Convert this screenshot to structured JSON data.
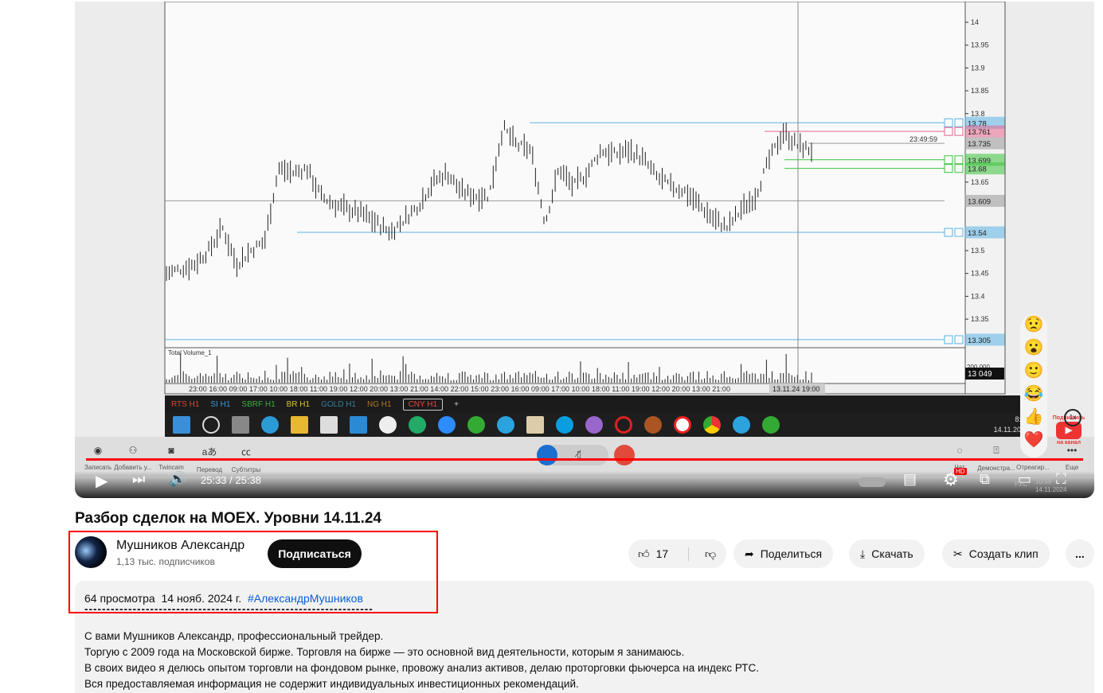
{
  "video": {
    "price_ticks": [
      "14",
      "13.95",
      "13.9",
      "13.85",
      "13.8",
      "13.65",
      "13.5",
      "13.45",
      "13.4",
      "13.35"
    ],
    "levels": [
      {
        "label": "13.78",
        "color": "#5ab4e6"
      },
      {
        "label": "13.761",
        "color": "#e8678f"
      },
      {
        "label": "13.735",
        "color": "#999999"
      },
      {
        "label": "13.699",
        "color": "#3cc43c"
      },
      {
        "label": "13.68",
        "color": "#3cc43c"
      },
      {
        "label": "13.609",
        "color": "#999999"
      },
      {
        "label": "13.54",
        "color": "#5ab4e6"
      },
      {
        "label": "13.305",
        "color": "#5ab4e6"
      }
    ],
    "price_path": [
      13.45,
      13.46,
      13.47,
      13.5,
      13.55,
      13.47,
      13.5,
      13.52,
      13.68,
      13.67,
      13.68,
      13.62,
      13.6,
      13.59,
      13.58,
      13.56,
      13.54,
      13.57,
      13.6,
      13.65,
      13.67,
      13.63,
      13.62,
      13.62,
      13.77,
      13.73,
      13.72,
      13.56,
      13.68,
      13.64,
      13.67,
      13.72,
      13.71,
      13.72,
      13.7,
      13.66,
      13.64,
      13.63,
      13.6,
      13.57,
      13.55,
      13.59,
      13.62,
      13.7,
      13.76,
      13.73,
      13.72
    ],
    "crosshair_time": "23:49:59",
    "volume_label": "Total Volume_1",
    "volume_axis": "200 000",
    "volume_value": "13 049",
    "time_axis": "23:00 16:00 09:00 17:00 10:00 18:00 11:00 19:00 12:00 20:00 13:00 21:00 14:00 22:00 15:00 23:00 16:00 09:00 17:00 10:00 18:00 11:00 19:00 12:00 20:00 13:00 21:00",
    "time_cursor": "13.11.24 19:00",
    "tabs": [
      {
        "label": "RTS H1",
        "color": "#d04a2a"
      },
      {
        "label": "SI H1",
        "color": "#3a9ad9"
      },
      {
        "label": "SBRF H1",
        "color": "#3fae3f"
      },
      {
        "label": "BR H1",
        "color": "#d9c33a"
      },
      {
        "label": "GOLD H1",
        "color": "#3a7fa0"
      },
      {
        "label": "NG H1",
        "color": "#b07a20"
      },
      {
        "label": "CNY H1",
        "color": "#e04a3a"
      },
      {
        "label": "+",
        "color": "#cccccc"
      }
    ],
    "taskbar_clock": {
      "time": "8:57",
      "date": "14.11.2024"
    },
    "meeting_items": [
      "Записать",
      "Добавить у...",
      "Twincam",
      "Перевод",
      "Субтитры"
    ],
    "meeting_right": [
      "Чат",
      "Демонстра...",
      "Отреагир...",
      "Еще"
    ],
    "subscribe_promo": [
      "Подпишись",
      "на канал"
    ],
    "speed": "1x",
    "time": "25:33 / 25:38",
    "clock2": {
      "time": "10:59",
      "date": "14.11.2024",
      "lang": "РУС"
    },
    "hd": "HD"
  },
  "title": "Разбор сделок на MOEX. Уровни 14.11.24",
  "channel": {
    "name": "Мушников Александр",
    "subscribers": "1,13 тыс. подписчиков",
    "subscribe": "Подписаться"
  },
  "actions": {
    "likes": "17",
    "share": "Поделиться",
    "download": "Скачать",
    "clip": "Создать клип",
    "more": "..."
  },
  "description": {
    "views": "64 просмотра",
    "date": "14 нояб. 2024 г.",
    "hashtag": "#АлександрМушников",
    "divider": "------------------------------------------------------------------",
    "lines": [
      "С вами Мушников Александр, профессиональный трейдер.",
      "Торгую с 2009 года на Московской бирже. Торговля на бирже — это основной вид деятельности, которым я занимаюсь.",
      "В своих видео я делюсь опытом торговли на фондовом рынке, провожу анализ активов, делаю проторговки  фьючерса на индекс РТС.",
      "Вся предоставляемая информация не содержит индивидуальных инвестиционных рекомендаций."
    ]
  }
}
